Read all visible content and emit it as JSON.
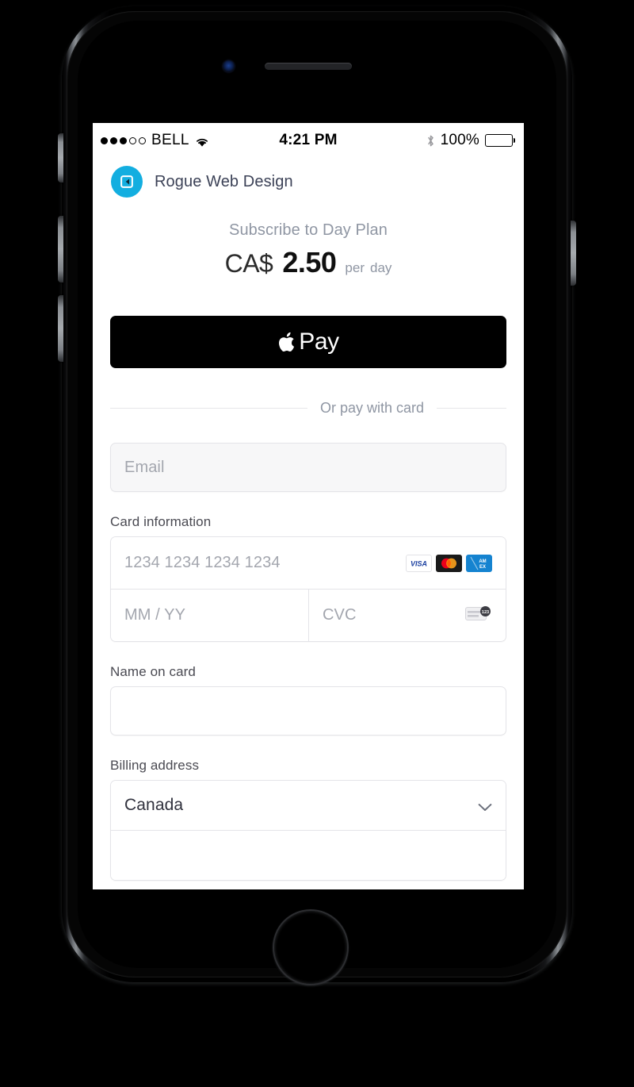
{
  "device": {
    "type": "iphone",
    "frame_color": "#1a1a1c",
    "accent": "#13aee0"
  },
  "status_bar": {
    "signal_dots_filled": 3,
    "signal_dots_total": 5,
    "carrier": "BELL",
    "wifi_icon": "wifi-icon",
    "time": "4:21 PM",
    "bluetooth_icon": "bluetooth-icon",
    "battery_percent": "100%",
    "battery_level": 100
  },
  "merchant": {
    "logo_icon": "rogue-web-design-logo",
    "name": "Rogue Web Design",
    "logo_color": "#13aee0"
  },
  "plan": {
    "title": "Subscribe to Day Plan",
    "currency": "CA$",
    "amount": "2.50",
    "per_label": "per",
    "per_unit": "day"
  },
  "apple_pay": {
    "icon": "apple-logo-icon",
    "label": "Pay",
    "background": "#000000"
  },
  "divider": {
    "text": "Or pay with card"
  },
  "form": {
    "email": {
      "placeholder": "Email",
      "value": ""
    },
    "card_information": {
      "label": "Card information",
      "number_placeholder": "1234 1234 1234 1234",
      "number_value": "",
      "expiry_placeholder": "MM / YY",
      "expiry_value": "",
      "cvc_placeholder": "CVC",
      "cvc_value": "",
      "brands": [
        "visa-icon",
        "mastercard-icon",
        "amex-icon"
      ],
      "cvc_hint_icon": "cvc-card-icon"
    },
    "name_on_card": {
      "label": "Name on card",
      "placeholder": "",
      "value": ""
    },
    "billing_address": {
      "label": "Billing address",
      "country_value": "Canada",
      "country_options": [
        "Canada"
      ],
      "chevron_icon": "chevron-down-icon",
      "address_placeholder": "",
      "address_value": ""
    }
  }
}
